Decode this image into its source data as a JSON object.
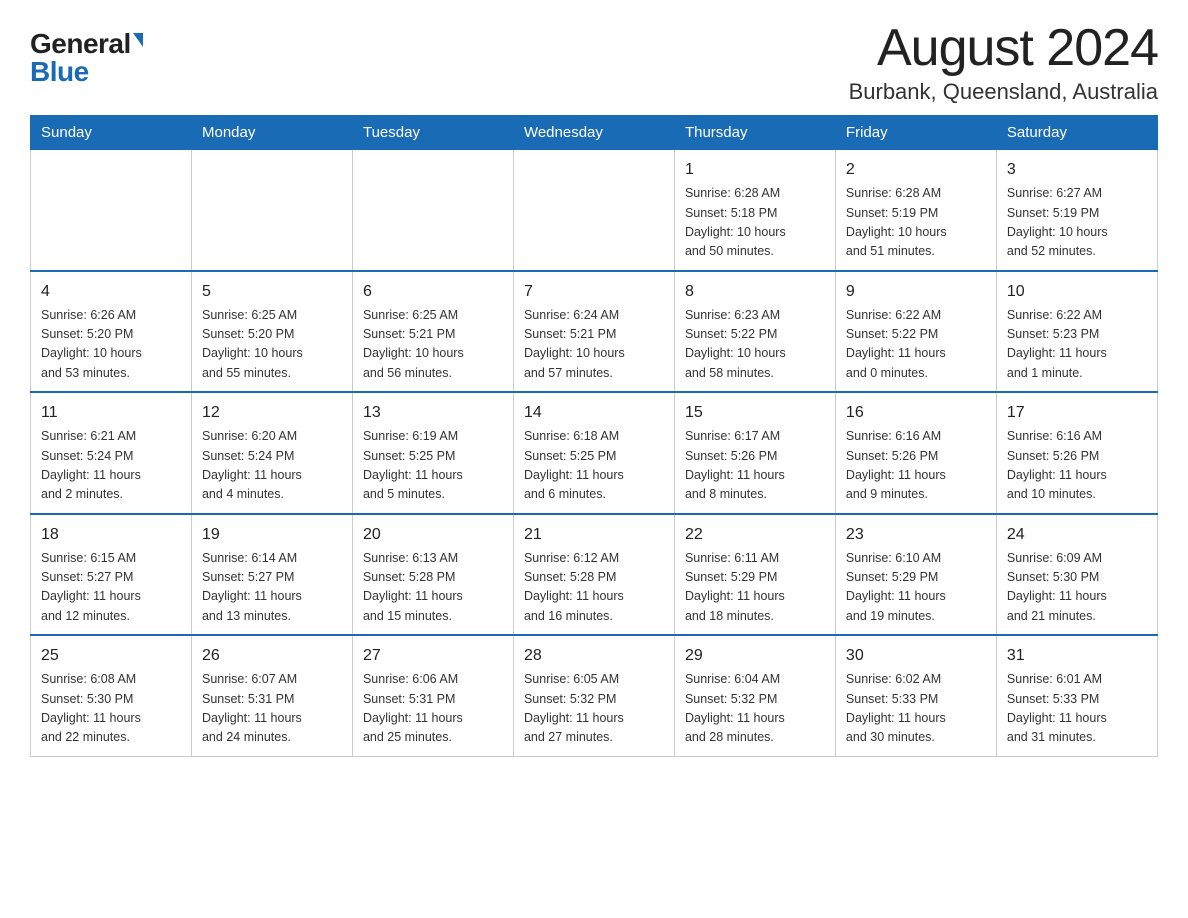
{
  "header": {
    "logo_general": "General",
    "logo_blue": "Blue",
    "month_title": "August 2024",
    "location": "Burbank, Queensland, Australia"
  },
  "days_of_week": [
    "Sunday",
    "Monday",
    "Tuesday",
    "Wednesday",
    "Thursday",
    "Friday",
    "Saturday"
  ],
  "weeks": [
    [
      {
        "day": "",
        "info": ""
      },
      {
        "day": "",
        "info": ""
      },
      {
        "day": "",
        "info": ""
      },
      {
        "day": "",
        "info": ""
      },
      {
        "day": "1",
        "info": "Sunrise: 6:28 AM\nSunset: 5:18 PM\nDaylight: 10 hours\nand 50 minutes."
      },
      {
        "day": "2",
        "info": "Sunrise: 6:28 AM\nSunset: 5:19 PM\nDaylight: 10 hours\nand 51 minutes."
      },
      {
        "day": "3",
        "info": "Sunrise: 6:27 AM\nSunset: 5:19 PM\nDaylight: 10 hours\nand 52 minutes."
      }
    ],
    [
      {
        "day": "4",
        "info": "Sunrise: 6:26 AM\nSunset: 5:20 PM\nDaylight: 10 hours\nand 53 minutes."
      },
      {
        "day": "5",
        "info": "Sunrise: 6:25 AM\nSunset: 5:20 PM\nDaylight: 10 hours\nand 55 minutes."
      },
      {
        "day": "6",
        "info": "Sunrise: 6:25 AM\nSunset: 5:21 PM\nDaylight: 10 hours\nand 56 minutes."
      },
      {
        "day": "7",
        "info": "Sunrise: 6:24 AM\nSunset: 5:21 PM\nDaylight: 10 hours\nand 57 minutes."
      },
      {
        "day": "8",
        "info": "Sunrise: 6:23 AM\nSunset: 5:22 PM\nDaylight: 10 hours\nand 58 minutes."
      },
      {
        "day": "9",
        "info": "Sunrise: 6:22 AM\nSunset: 5:22 PM\nDaylight: 11 hours\nand 0 minutes."
      },
      {
        "day": "10",
        "info": "Sunrise: 6:22 AM\nSunset: 5:23 PM\nDaylight: 11 hours\nand 1 minute."
      }
    ],
    [
      {
        "day": "11",
        "info": "Sunrise: 6:21 AM\nSunset: 5:24 PM\nDaylight: 11 hours\nand 2 minutes."
      },
      {
        "day": "12",
        "info": "Sunrise: 6:20 AM\nSunset: 5:24 PM\nDaylight: 11 hours\nand 4 minutes."
      },
      {
        "day": "13",
        "info": "Sunrise: 6:19 AM\nSunset: 5:25 PM\nDaylight: 11 hours\nand 5 minutes."
      },
      {
        "day": "14",
        "info": "Sunrise: 6:18 AM\nSunset: 5:25 PM\nDaylight: 11 hours\nand 6 minutes."
      },
      {
        "day": "15",
        "info": "Sunrise: 6:17 AM\nSunset: 5:26 PM\nDaylight: 11 hours\nand 8 minutes."
      },
      {
        "day": "16",
        "info": "Sunrise: 6:16 AM\nSunset: 5:26 PM\nDaylight: 11 hours\nand 9 minutes."
      },
      {
        "day": "17",
        "info": "Sunrise: 6:16 AM\nSunset: 5:26 PM\nDaylight: 11 hours\nand 10 minutes."
      }
    ],
    [
      {
        "day": "18",
        "info": "Sunrise: 6:15 AM\nSunset: 5:27 PM\nDaylight: 11 hours\nand 12 minutes."
      },
      {
        "day": "19",
        "info": "Sunrise: 6:14 AM\nSunset: 5:27 PM\nDaylight: 11 hours\nand 13 minutes."
      },
      {
        "day": "20",
        "info": "Sunrise: 6:13 AM\nSunset: 5:28 PM\nDaylight: 11 hours\nand 15 minutes."
      },
      {
        "day": "21",
        "info": "Sunrise: 6:12 AM\nSunset: 5:28 PM\nDaylight: 11 hours\nand 16 minutes."
      },
      {
        "day": "22",
        "info": "Sunrise: 6:11 AM\nSunset: 5:29 PM\nDaylight: 11 hours\nand 18 minutes."
      },
      {
        "day": "23",
        "info": "Sunrise: 6:10 AM\nSunset: 5:29 PM\nDaylight: 11 hours\nand 19 minutes."
      },
      {
        "day": "24",
        "info": "Sunrise: 6:09 AM\nSunset: 5:30 PM\nDaylight: 11 hours\nand 21 minutes."
      }
    ],
    [
      {
        "day": "25",
        "info": "Sunrise: 6:08 AM\nSunset: 5:30 PM\nDaylight: 11 hours\nand 22 minutes."
      },
      {
        "day": "26",
        "info": "Sunrise: 6:07 AM\nSunset: 5:31 PM\nDaylight: 11 hours\nand 24 minutes."
      },
      {
        "day": "27",
        "info": "Sunrise: 6:06 AM\nSunset: 5:31 PM\nDaylight: 11 hours\nand 25 minutes."
      },
      {
        "day": "28",
        "info": "Sunrise: 6:05 AM\nSunset: 5:32 PM\nDaylight: 11 hours\nand 27 minutes."
      },
      {
        "day": "29",
        "info": "Sunrise: 6:04 AM\nSunset: 5:32 PM\nDaylight: 11 hours\nand 28 minutes."
      },
      {
        "day": "30",
        "info": "Sunrise: 6:02 AM\nSunset: 5:33 PM\nDaylight: 11 hours\nand 30 minutes."
      },
      {
        "day": "31",
        "info": "Sunrise: 6:01 AM\nSunset: 5:33 PM\nDaylight: 11 hours\nand 31 minutes."
      }
    ]
  ]
}
